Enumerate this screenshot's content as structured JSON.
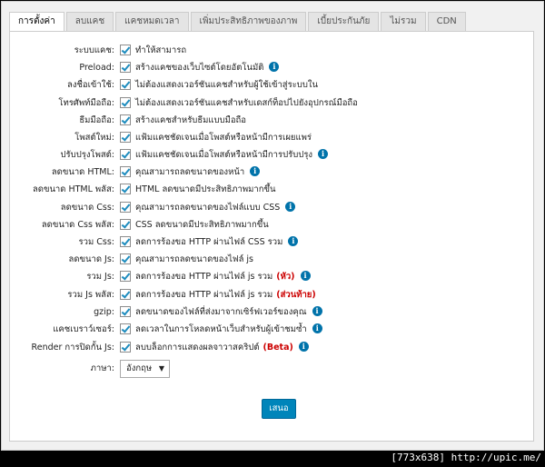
{
  "tabs": [
    {
      "label": "การตั้งค่า",
      "active": true
    },
    {
      "label": "ลบแคช",
      "active": false
    },
    {
      "label": "แคชหมดเวลา",
      "active": false
    },
    {
      "label": "เพิ่มประสิทธิภาพของภาพ",
      "active": false
    },
    {
      "label": "เบี้ยประกันภัย",
      "active": false
    },
    {
      "label": "ไม่รวม",
      "active": false
    },
    {
      "label": "CDN",
      "active": false
    }
  ],
  "settings": [
    {
      "label": "ระบบแคช:",
      "desc": "ทำให้สามารถ",
      "info": false,
      "checked": true
    },
    {
      "label": "Preload:",
      "desc": "สร้างแคชของเว็บไซต์โดยอัตโนมัติ",
      "info": true,
      "checked": true
    },
    {
      "label": "ลงชื่อเข้าใช้:",
      "desc": "ไม่ต้องแสดงเวอร์ชันแคชสำหรับผู้ใช้เข้าสู่ระบบใน",
      "info": false,
      "checked": true
    },
    {
      "label": "โทรศัพท์มือถือ:",
      "desc": "ไม่ต้องแสดงเวอร์ชันแคชสำหรับเดสก์ท็อปไปยังอุปกรณ์มือถือ",
      "info": false,
      "checked": true
    },
    {
      "label": "ธีมมือถือ:",
      "desc": "สร้างแคชสำหรับธีมแบบมือถือ",
      "info": false,
      "checked": true
    },
    {
      "label": "โพสต์ใหม่:",
      "desc": "แฟ้มแคชชัดเจนเมื่อโพสต์หรือหน้ามีการเผยแพร่",
      "info": false,
      "checked": true
    },
    {
      "label": "ปรับปรุงโพสต์:",
      "desc": "แฟ้มแคชชัดเจนเมื่อโพสต์หรือหน้ามีการปรับปรุง",
      "info": true,
      "checked": true
    },
    {
      "label": "ลดขนาด HTML:",
      "desc": "คุณสามารถลดขนาดของหน้า",
      "info": true,
      "checked": true
    },
    {
      "label": "ลดขนาด HTML พลัส:",
      "desc": "HTML ลดขนาดมีประสิทธิภาพมากขึ้น",
      "info": false,
      "checked": true
    },
    {
      "label": "ลดขนาด Css:",
      "desc": "คุณสามารถลดขนาดของไฟล์แบบ CSS",
      "info": true,
      "checked": true
    },
    {
      "label": "ลดขนาด Css พลัส:",
      "desc": "CSS ลดขนาดมีประสิทธิภาพมากขึ้น",
      "info": false,
      "checked": true
    },
    {
      "label": "รวม Css:",
      "desc": "ลดการร้องขอ HTTP ผ่านไฟล์ CSS รวม",
      "info": true,
      "checked": true
    },
    {
      "label": "ลดขนาด Js:",
      "desc": "คุณสามารถลดขนาดของไฟล์ js",
      "info": false,
      "checked": true
    },
    {
      "label": "รวม Js:",
      "desc": "ลดการร้องขอ HTTP ผ่านไฟล์ js รวม",
      "red": "(หัว)",
      "info": true,
      "checked": true
    },
    {
      "label": "รวม Js พลัส:",
      "desc": "ลดการร้องขอ HTTP ผ่านไฟล์ js รวม",
      "red": "(ส่วนท้าย)",
      "info": false,
      "checked": true
    },
    {
      "label": "gzip:",
      "desc": "ลดขนาดของไฟล์ที่ส่งมาจากเซิร์ฟเวอร์ของคุณ",
      "info": true,
      "checked": true
    },
    {
      "label": "แคชเบราว์เซอร์:",
      "desc": "ลดเวลาในการโหลดหน้าเว็บสำหรับผู้เข้าชมซ้ำ",
      "info": true,
      "checked": true
    },
    {
      "label": "Render การปิดกั้น Js:",
      "desc": "ลบบล็อกการแสดงผลจาวาสคริปต์",
      "red": "(Beta)",
      "info": true,
      "checked": true
    }
  ],
  "language": {
    "label": "ภาษา:",
    "value": "อังกฤษ"
  },
  "submit_label": "เสนอ",
  "watermark": "[773x638] http://upic.me/"
}
